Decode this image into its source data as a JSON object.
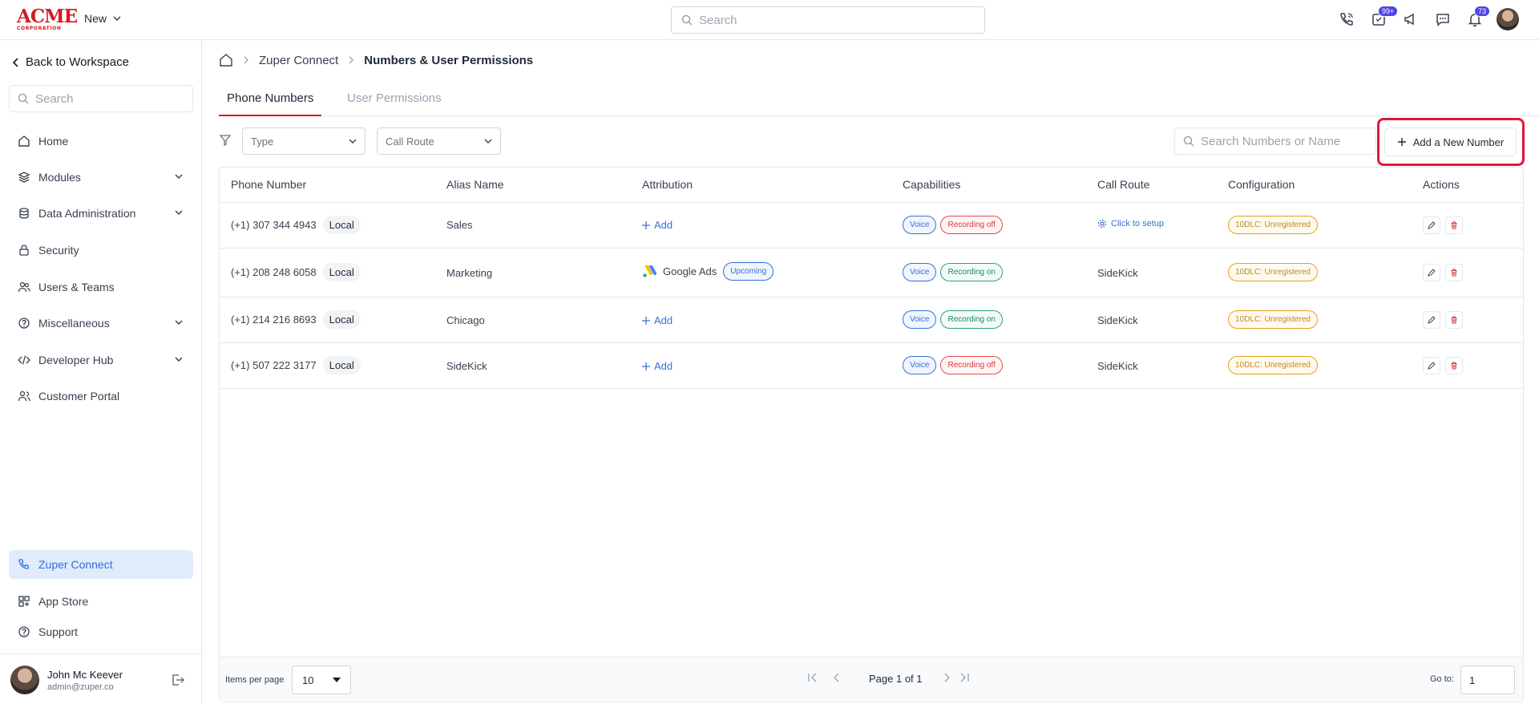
{
  "brand": {
    "line1": "ACME",
    "line2": "CORPORATION",
    "color": "#d71920"
  },
  "topbar": {
    "new_label": "New",
    "search_placeholder": "Search",
    "badges": {
      "tasks": "99+",
      "notifications": "73"
    }
  },
  "sidebar": {
    "back_label": "Back to Workspace",
    "search_placeholder": "Search",
    "items": [
      {
        "label": "Home",
        "icon": "home-icon"
      },
      {
        "label": "Modules",
        "icon": "layers-icon"
      },
      {
        "label": "Data Administration",
        "icon": "database-icon"
      },
      {
        "label": "Security",
        "icon": "lock-icon"
      },
      {
        "label": "Users & Teams",
        "icon": "users-icon"
      },
      {
        "label": "Miscellaneous",
        "icon": "question-icon"
      },
      {
        "label": "Developer Hub",
        "icon": "code-icon"
      },
      {
        "label": "Customer Portal",
        "icon": "user-group-icon"
      }
    ],
    "bottom_items": [
      {
        "label": "Zuper Connect",
        "icon": "phone-icon"
      },
      {
        "label": "App Store",
        "icon": "grid-icon"
      },
      {
        "label": "Support",
        "icon": "help-icon"
      }
    ],
    "user": {
      "name": "John Mc Keever",
      "email": "admin@zuper.co"
    }
  },
  "breadcrumb": {
    "parent": "Zuper Connect",
    "current": "Numbers & User Permissions"
  },
  "tabs": [
    {
      "label": "Phone Numbers"
    },
    {
      "label": "User Permissions"
    }
  ],
  "filters": {
    "type": "Type",
    "call_route": "Call Route",
    "search_placeholder": "Search Numbers or Name"
  },
  "add_button_label": "Add a New Number",
  "table": {
    "headers": [
      "Phone Number",
      "Alias Name",
      "Attribution",
      "Capabilities",
      "Call Route",
      "Configuration",
      "Actions"
    ],
    "rows": [
      {
        "phone": "(+1) 307 344 4943",
        "type": "Local",
        "alias": "Sales",
        "attribution": "Add",
        "voice": "Voice",
        "recording": "Recording off",
        "route": "Click to setup",
        "config": "10DLC: Unregistered"
      },
      {
        "phone": "(+1) 208 248 6058",
        "type": "Local",
        "alias": "Marketing",
        "attribution": "Google Ads",
        "attribution_badge": "Upcoming",
        "voice": "Voice",
        "recording": "Recording on",
        "route": "SideKick",
        "config": "10DLC: Unregistered"
      },
      {
        "phone": "(+1) 214 216 8693",
        "type": "Local",
        "alias": "Chicago",
        "attribution": "Add",
        "voice": "Voice",
        "recording": "Recording on",
        "route": "SideKick",
        "config": "10DLC: Unregistered"
      },
      {
        "phone": "(+1) 507 222 3177",
        "type": "Local",
        "alias": "SideKick",
        "attribution": "Add",
        "voice": "Voice",
        "recording": "Recording off",
        "route": "SideKick",
        "config": "10DLC: Unregistered"
      }
    ]
  },
  "pagination": {
    "items_per_page_label": "Items per page",
    "items_per_page": "10",
    "page_info": "Page 1 of 1",
    "goto_label": "Go to:",
    "goto_value": "1"
  }
}
